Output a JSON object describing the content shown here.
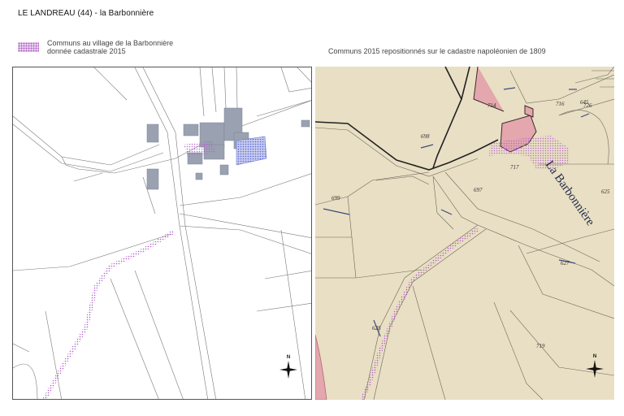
{
  "title": "LE LANDREAU (44) - la Barbonnière",
  "legend": {
    "line1": "Communs au village de la Barbonnière",
    "line2": "donnée cadastrale 2015",
    "color": "#b060c8"
  },
  "right_caption": "Communs 2015 repositionnés sur le cadastre napoléonien de 1809",
  "left_map": {
    "north_label": "N",
    "building_color": "#9aa2b2",
    "common_color": "#6a78d8"
  },
  "right_map": {
    "place_name": "La Barbonnière",
    "north_label": "N",
    "paper_color": "#e9dfc4",
    "building_color": "#e3a7ad",
    "parcel_numbers": [
      "714",
      "716",
      "726",
      "717",
      "698",
      "697",
      "699",
      "625",
      "627",
      "628",
      "719",
      "645"
    ]
  }
}
